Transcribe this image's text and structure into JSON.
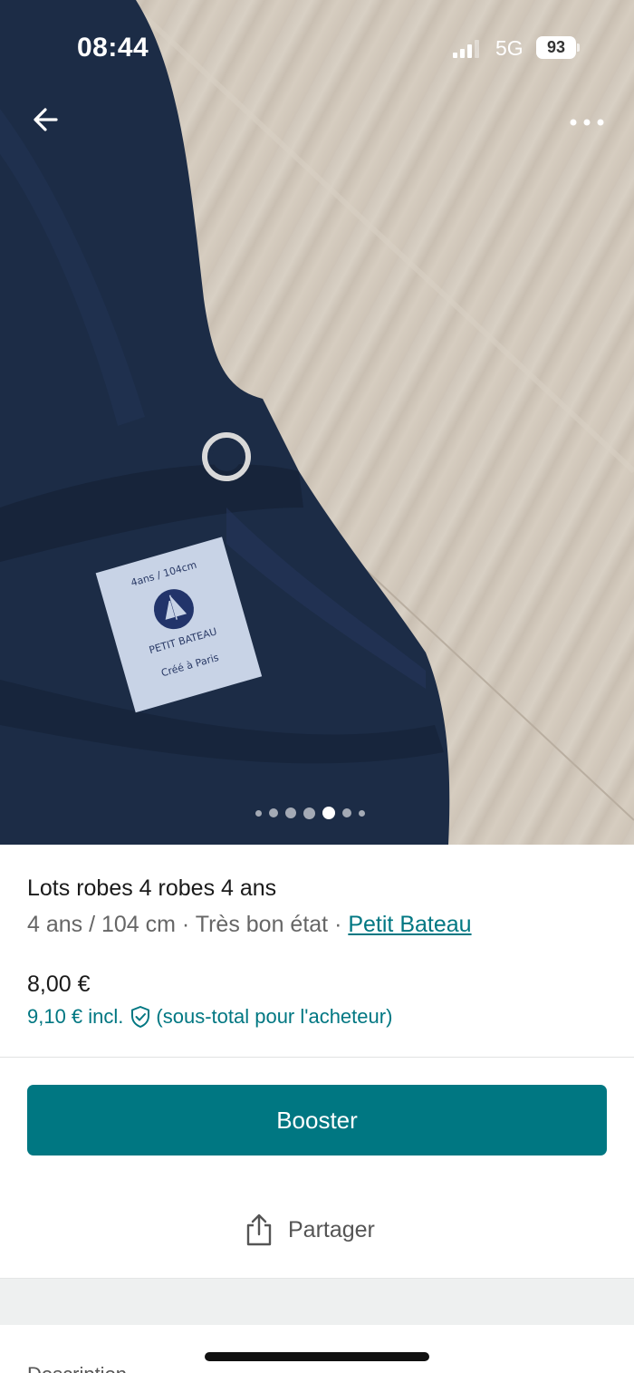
{
  "status_bar": {
    "time": "08:44",
    "network": "5G",
    "battery": "93"
  },
  "nav": {
    "back_icon": "arrow-left-icon",
    "more_icon": "ellipsis-icon"
  },
  "gallery": {
    "photo_count": 7,
    "active_index": 4,
    "label_text": {
      "size": "4ans / 104cm",
      "brand": "PETIT BATEAU",
      "origin": "Créé à Paris"
    }
  },
  "listing": {
    "title": "Lots robes 4 robes  4 ans",
    "size": "4 ans / 104 cm",
    "separator": " · ",
    "condition": "Très bon état",
    "brand": "Petit Bateau",
    "price": "8,00 €",
    "price_incl": "9,10 € incl.",
    "price_incl_note": "(sous-total pour l'acheteur)"
  },
  "actions": {
    "booster_label": "Booster",
    "share_label": "Partager"
  },
  "sections": {
    "description_label": "Description"
  },
  "colors": {
    "accent": "#007782",
    "fabric": "#1c2c46",
    "floor": "#d3cabd"
  }
}
